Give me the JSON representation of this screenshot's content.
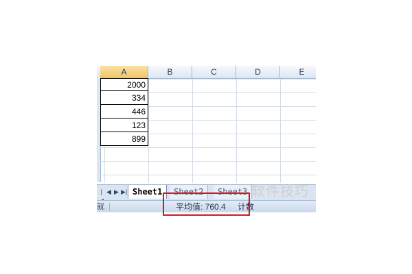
{
  "spreadsheet": {
    "columns": [
      "A",
      "B",
      "C",
      "D",
      "E"
    ],
    "selected_column": "A",
    "column_a_values": [
      "2000",
      "334",
      "446",
      "123",
      "899"
    ]
  },
  "sheet_tabs": {
    "nav_buttons": [
      "|◀",
      "◀",
      "▶",
      "▶|"
    ],
    "tabs": [
      "Sheet1",
      "Sheet2",
      "Sheet3"
    ],
    "active_tab": "Sheet1"
  },
  "status_bar": {
    "ready_label": "就绪",
    "average_text": "平均值: 760.4",
    "count_text": "计数"
  },
  "watermark": {
    "text": "软件技巧"
  },
  "colors": {
    "highlight_border": "#d8161b",
    "header_bg": "#dde6f1",
    "selected_header": "#f2c465"
  }
}
